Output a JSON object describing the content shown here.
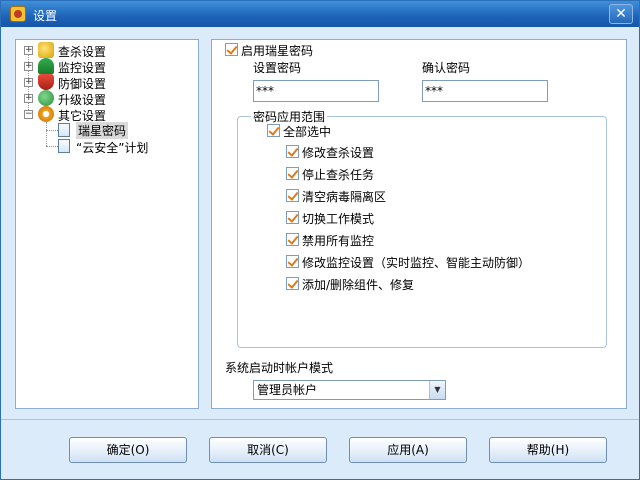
{
  "window": {
    "title": "设置",
    "close_glyph": "✕"
  },
  "tree": {
    "items": [
      {
        "label": "查杀设置",
        "icon": "magnifier-icon",
        "expander": "+"
      },
      {
        "label": "监控设置",
        "icon": "umbrella-icon",
        "expander": "+"
      },
      {
        "label": "防御设置",
        "icon": "shield-icon",
        "expander": "+"
      },
      {
        "label": "升级设置",
        "icon": "update-check-icon",
        "expander": "+"
      },
      {
        "label": "其它设置",
        "icon": "gear-icon",
        "expander": "−"
      }
    ],
    "children": [
      {
        "label": "瑞星密码",
        "selected": true
      },
      {
        "label": "“云安全”计划",
        "selected": false
      }
    ]
  },
  "password": {
    "enable_label": "启用瑞星密码",
    "set_label": "设置密码",
    "set_value": "***",
    "confirm_label": "确认密码",
    "confirm_value": "***"
  },
  "scope": {
    "legend": "密码应用范围",
    "select_all": "全部选中",
    "options": [
      "修改查杀设置",
      "停止查杀任务",
      "清空病毒隔离区",
      "切换工作模式",
      "禁用所有监控",
      "修改监控设置（实时监控、智能主动防御）",
      "添加/删除组件、修复"
    ]
  },
  "account": {
    "label": "系统启动时帐户模式",
    "selected": "管理员帐户"
  },
  "buttons": {
    "ok": "确定(O)",
    "cancel": "取消(C)",
    "apply": "应用(A)",
    "help": "帮助(H)"
  },
  "colors": {
    "titlebar": "#1d63b8",
    "window_bg": "#dcebf9",
    "check_mark": "#e07a12"
  }
}
